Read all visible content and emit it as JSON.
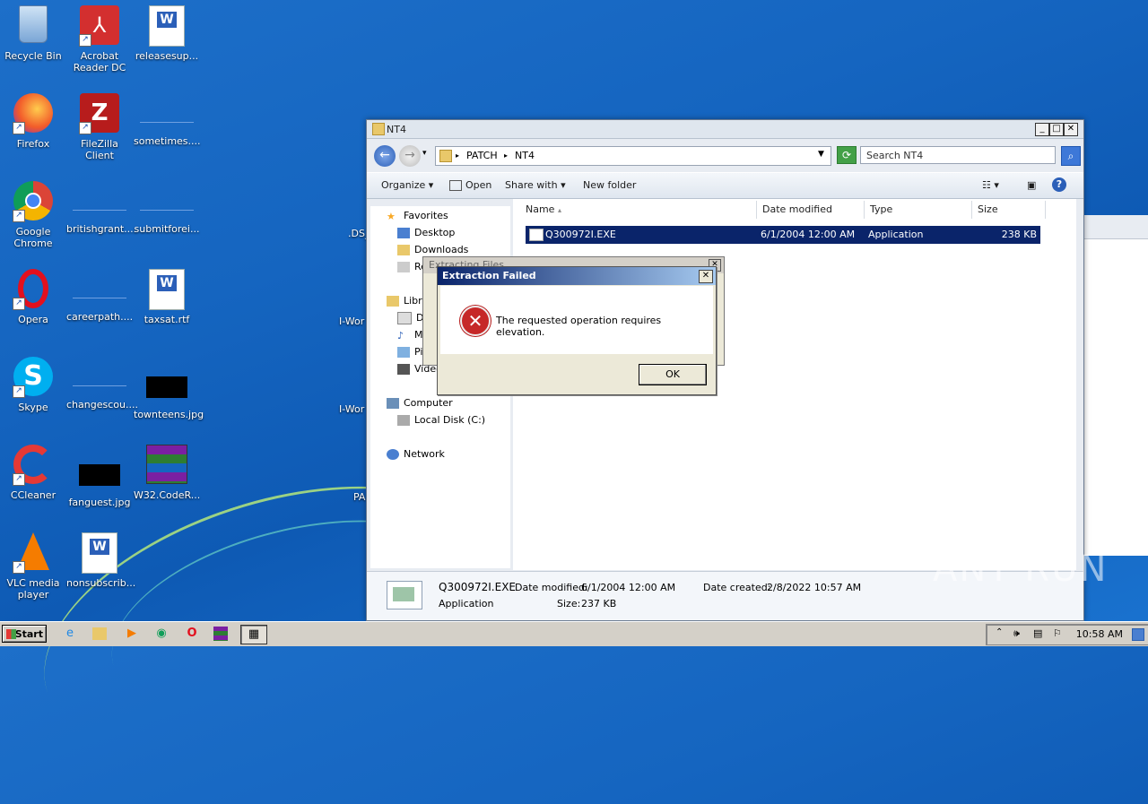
{
  "desktop": {
    "icons": [
      {
        "label": "Recycle Bin"
      },
      {
        "label": "Acrobat Reader DC"
      },
      {
        "label": "releasesup..."
      },
      {
        "label": "Firefox"
      },
      {
        "label": "FileZilla Client"
      },
      {
        "label": "sometimes...."
      },
      {
        "label": "Google Chrome"
      },
      {
        "label": "britishgrant...."
      },
      {
        "label": "submitforei..."
      },
      {
        "label": "Opera"
      },
      {
        "label": "careerpath...."
      },
      {
        "label": "taxsat.rtf"
      },
      {
        "label": "Skype"
      },
      {
        "label": "changescou...."
      },
      {
        "label": "townteens.jpg"
      },
      {
        "label": "CCleaner"
      },
      {
        "label": "fanguest.jpg"
      },
      {
        "label": "W32.CodeR..."
      },
      {
        "label": "VLC media player"
      },
      {
        "label": "nonsubscrib..."
      }
    ],
    "partial_labels": [
      ".DS_",
      "I-Wor",
      "I-Wor",
      "PA"
    ]
  },
  "explorer": {
    "title": "NT4",
    "path": [
      "PATCH",
      "NT4"
    ],
    "search_placeholder": "Search NT4",
    "toolbar": {
      "organize": "Organize",
      "open": "Open",
      "share_with": "Share with",
      "new_folder": "New folder"
    },
    "nav": {
      "favorites": "Favorites",
      "desktop": "Desktop",
      "downloads": "Downloads",
      "recent": "Re",
      "libraries": "Libra",
      "doc": "Do",
      "music": "Mu",
      "pictures": "Pi",
      "videos": "Video",
      "computer": "Computer",
      "local_disk": "Local Disk (C:)",
      "network": "Network"
    },
    "columns": {
      "name": "Name",
      "date": "Date modified",
      "type": "Type",
      "size": "Size"
    },
    "files": [
      {
        "name": "Q300972I.EXE",
        "date": "6/1/2004 12:00 AM",
        "type": "Application",
        "size": "238 KB"
      }
    ],
    "details": {
      "name": "Q300972I.EXE",
      "type": "Application",
      "modified_label": "Date modified:",
      "modified": "6/1/2004 12:00 AM",
      "created_label": "Date created:",
      "created": "2/8/2022 10:57 AM",
      "size_label": "Size:",
      "size": "237 KB"
    }
  },
  "dialog_back": {
    "title": "Extracting Files"
  },
  "dialog": {
    "title": "Extraction Failed",
    "message": "The requested operation requires elevation.",
    "ok": "OK"
  },
  "taskbar": {
    "start": "Start",
    "clock": "10:58 AM"
  },
  "watermark": "ANY RUN"
}
